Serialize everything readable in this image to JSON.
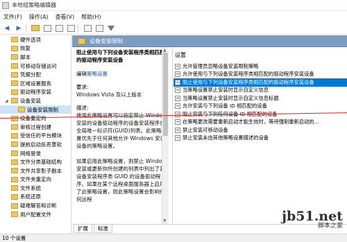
{
  "window": {
    "title": "本地组策略编辑器"
  },
  "menubar": {
    "items": [
      "文件(F)",
      "操作(A)",
      "查看(V)",
      "帮助(H)"
    ]
  },
  "tree": {
    "items": [
      {
        "label": "硬件选项",
        "level": "top",
        "selected": false
      },
      {
        "label": "恢复",
        "level": "top",
        "selected": false
      },
      {
        "label": "脚本",
        "level": "top",
        "selected": false
      },
      {
        "label": "可移动存储访问",
        "level": "top",
        "selected": false
      },
      {
        "label": "凭据分配",
        "level": "top",
        "selected": false
      },
      {
        "label": "区域设置服务",
        "level": "top",
        "selected": false
      },
      {
        "label": "驱动程序安装",
        "level": "top",
        "selected": false
      },
      {
        "label": "设备安装",
        "level": "top",
        "selected": false,
        "expanded": true
      },
      {
        "label": "设备安装限制",
        "level": "child",
        "selected": true
      },
      {
        "label": "设备重定向",
        "level": "top",
        "selected": false
      },
      {
        "label": "审核过程创建",
        "level": "top",
        "selected": false
      },
      {
        "label": "受信任的平台模块",
        "level": "top",
        "selected": false
      },
      {
        "label": "提前启动反恶意软",
        "level": "top",
        "selected": false
      },
      {
        "label": "网络登录",
        "level": "top",
        "selected": false
      },
      {
        "label": "文件分类基础结构",
        "level": "top",
        "selected": false
      },
      {
        "label": "文件共享影子副本",
        "level": "top",
        "selected": false
      },
      {
        "label": "文件夹重定向",
        "level": "top",
        "selected": false
      },
      {
        "label": "文件系统",
        "level": "top",
        "selected": false
      },
      {
        "label": "系统还原",
        "level": "top",
        "selected": false
      },
      {
        "label": "疑难解答和诊断",
        "level": "top",
        "selected": false
      },
      {
        "label": "用户配置文件",
        "level": "top",
        "selected": false
      }
    ]
  },
  "header": {
    "title": "设备安装限制"
  },
  "description": {
    "title": "阻止使用与下列设备安装程序类相匹配的驱动程序安装设备",
    "edit_prefix": "编辑",
    "edit_link": "策略设置",
    "requirements_label": "要求:",
    "requirements_value": "Windows Vista 及以上版本",
    "desc_label": "描述:",
    "body": "使用此策略设置可以指定禁止 Windows 安装的设备驱动程序的设备安装程序类全局唯一标识符(GUID)列表。此策略设置优先于任何其他允许 Windows 安装设备的策略设置。\n\n如果启用此策略设置，则禁止 Windows 安装或更新你所创建的列表中列出了其设备安装程序类 GUID 的设备驱动程序。如果在某个远程桌面服务器上启用了此策略设置，则此策略设置会影响任何远程"
  },
  "settings": {
    "header": "设置",
    "rows": [
      {
        "label": "允许管理员忽略设备安装限制策略",
        "selected": false
      },
      {
        "label": "允许使用与下列设备安装程序类相匹配的驱动程序安装设备",
        "selected": false
      },
      {
        "label": "阻止使用与下列设备安装程序类相匹配的驱动程序安装设备",
        "selected": true
      },
      {
        "label": "当策略设置禁止安装时显示自定义信息",
        "selected": false
      },
      {
        "label": "当策略设置禁止安装时显示自定义信息标题",
        "selected": false
      },
      {
        "label": "允许安装与下列设备 ID 相匹配的设备",
        "selected": false
      },
      {
        "label": "阻止安装与下列任何设备 ID 相匹配的设备",
        "selected": false
      },
      {
        "label": "在策略更改需要重新启动才能生效时，等待强制重新启动的...",
        "selected": false
      },
      {
        "label": "禁止安装可移动设备",
        "selected": false
      },
      {
        "label": "禁止安装未由其他策略设置描述的设备",
        "selected": false
      }
    ]
  },
  "tabs": {
    "items": [
      "扩展",
      "标准"
    ],
    "active": 0
  },
  "statusbar": {
    "text": "10 个设置"
  },
  "watermark": {
    "big": "jb51.net",
    "small": "脚本之家"
  },
  "colors": {
    "header_band": "#7a9cc3",
    "selection": "#0078d7",
    "annotation_line": "#e02020"
  }
}
